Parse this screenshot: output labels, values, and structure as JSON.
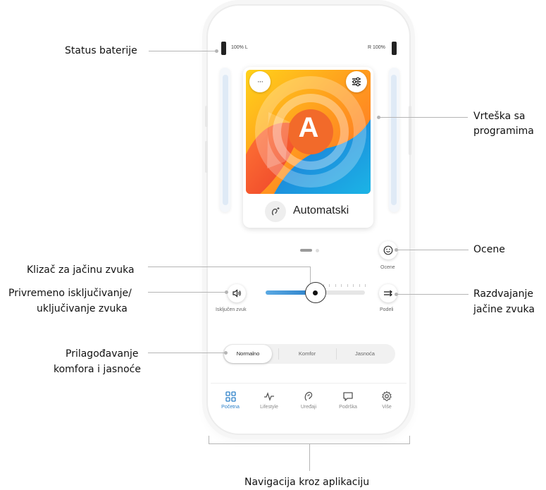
{
  "callouts": {
    "battery_status": "Status baterije",
    "program_carousel_1": "Vrteška sa",
    "program_carousel_2": "programima",
    "ratings": "Ocene",
    "volume_slider": "Klizač za jačinu zvuka",
    "mute_1": "Privremeno isključivanje/",
    "mute_2": "uključivanje zvuka",
    "split_1": "Razdvajanje",
    "split_2": "jačine zvuka",
    "comfort_1": "Prilagođavanje",
    "comfort_2": "komfora i jasnoće",
    "navigation": "Navigacija kroz aplikaciju"
  },
  "status": {
    "left_battery": "100% L",
    "right_battery": "R 100%"
  },
  "program": {
    "letter": "A",
    "name": "Automatski",
    "more_symbol": "···"
  },
  "controls": {
    "ratings_label": "Ocene",
    "mute_label": "Isključen zvuk",
    "split_label": "Podeli"
  },
  "volume": {
    "level": 0.5,
    "ticks": 8
  },
  "modes": {
    "items": [
      "Normalno",
      "Komfor",
      "Jasnoća"
    ],
    "selected": 0
  },
  "nav": {
    "items": [
      "Početna",
      "Lifestyle",
      "Uređaji",
      "Podrška",
      "Više"
    ],
    "active": 0
  },
  "colors": {
    "accent": "#2a7fc8",
    "slider_start": "#5aa9e3"
  },
  "icons": [
    "ellipsis-icon",
    "sliders-icon",
    "hearing-aid-icon",
    "smiley-icon",
    "speaker-icon",
    "split-icon",
    "grid-icon",
    "activity-icon",
    "ear-icon",
    "chat-icon",
    "gear-icon"
  ]
}
